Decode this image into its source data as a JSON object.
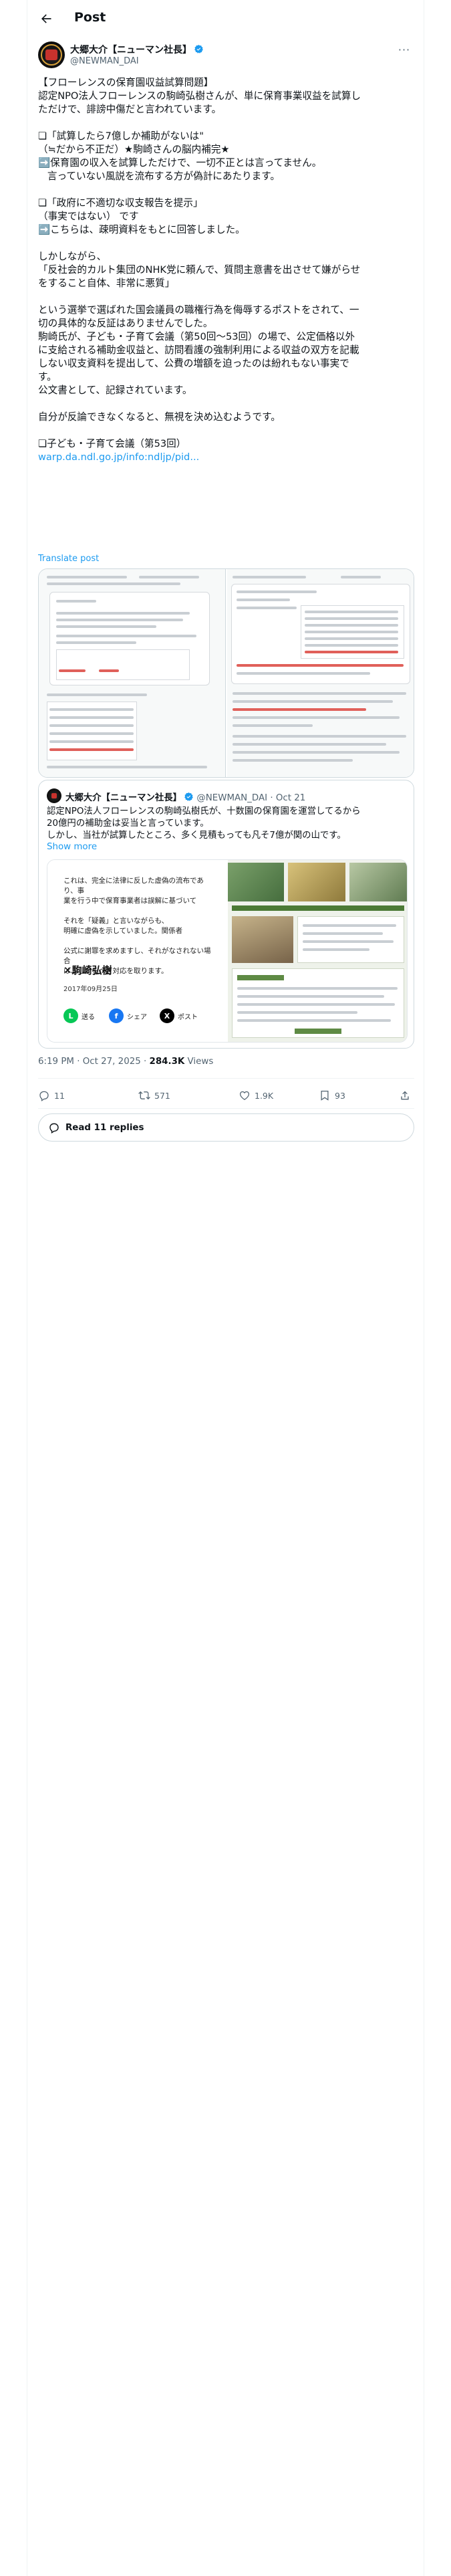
{
  "header": {
    "title": "Post",
    "back_icon": "arrow-left-icon"
  },
  "post": {
    "author": {
      "name": "大郷大介【ニューマン社長】",
      "handle": "@NEWMAN_DAI",
      "verified": true
    },
    "lines": [
      "【フローレンスの保育園収益試算問題】",
      "認定NPO法人フローレンスの駒崎弘樹さんが、単に保育事業収益を試算し",
      "ただけで、誹謗中傷だと言われています。",
      "",
      "❏「試算したら7億しか補助がないは\"",
      "（≒だから不正だ）★駒崎さんの脳内補完★",
      "➡️保育園の収入を試算しただけで、一切不正とは言ってません。",
      "   言っていない風説を流布する方が偽計にあたります。",
      "",
      "❏「政府に不適切な収支報告を提示」",
      "（事実ではない） です",
      "➡️こちらは、疎明資料をもとに回答しました。",
      "",
      "しかしながら、",
      "「反社会的カルト集団のNHK党に頼んで、質問主意書を出させて嫌がらせ",
      "をすること自体、非常に悪質」",
      "",
      "という選挙で選ばれた国会議員の職権行為を侮辱するポストをされて、一",
      "切の具体的な反証はありませんでした。",
      "駒崎氏が、子ども・子育て会議（第50回〜53回）の場で、公定価格以外",
      "に支給される補助金収益と、訪問看護の強制利用による収益の双方を記載",
      "しない収支資料を提出して、公費の増額を迫ったのは紛れもない事実で",
      "す。",
      "公文書として、記録されています。",
      "",
      "自分が反論できなくなると、無視を決め込むようです。",
      "",
      "❏子ども・子育て会議（第53回）"
    ],
    "link": "warp.da.ndl.go.jp/info:ndljp/pid...",
    "translate": "Translate post",
    "timestamp": "6:19 PM · Oct 27, 2025",
    "views": "284.3K",
    "views_label": "Views"
  },
  "quote": {
    "author_name": "大郷大介【ニューマン社長】",
    "handle": "@NEWMAN_DAI",
    "date": "Oct 21",
    "text": "認定NPO法人フローレンスの駒崎弘樹氏が、十数園の保育園を運営してるから\n20億円の補助金は妥当と言っています。\nしかし、当社が試算したところ、多く見積もっても凡そ7億が関の山です。",
    "show_more": "Show more",
    "media_text": [
      "これは、完全に法律に反した虚偽の流布であり、事",
      "業を行う中で保育事業者は誤解に基づいて",
      "",
      "それを「疑義」と言いながらも、",
      "明確に虚偽を示していました。関係者",
      "",
      "公式に謝罪を求めますし、それがなされない場合",
      "は、しかるべき対応を取ります。"
    ],
    "signature": "✕駒崎弘樹",
    "media_date": "2017年09月25日",
    "share": [
      "送る",
      "シェア",
      "ポスト"
    ]
  },
  "actions": {
    "replies": "11",
    "reposts": "571",
    "likes": "1.9K",
    "bookmarks": "93"
  },
  "read_replies": "Read 11 replies"
}
